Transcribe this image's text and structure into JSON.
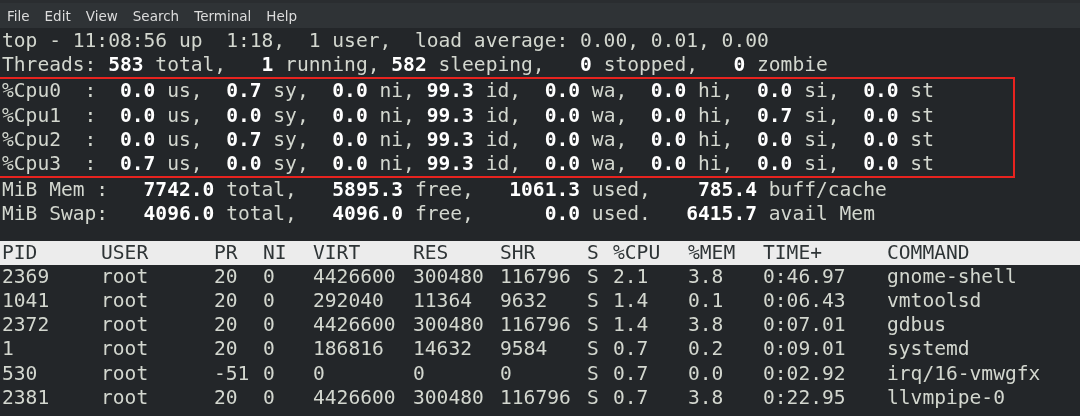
{
  "menu": [
    "File",
    "Edit",
    "View",
    "Search",
    "Terminal",
    "Help"
  ],
  "summary_lines": [
    "top - 11:08:56 up  1:18,  1 user,  load average: 0.00, 0.01, 0.00",
    "Threads: **583** total,   **1** running, **582** sleeping,   **0** stopped,   **0** zombie"
  ],
  "highlight_box": {
    "lines": [
      "%Cpu0  :  **0.0** us,  **0.7** sy,  **0.0** ni, **99.3** id,  **0.0** wa,  **0.0** hi,  **0.0** si,  **0.0** st",
      "%Cpu1  :  **0.0** us,  **0.0** sy,  **0.0** ni, **99.3** id,  **0.0** wa,  **0.0** hi,  **0.7** si,  **0.0** st",
      "%Cpu2  :  **0.0** us,  **0.7** sy,  **0.0** ni, **99.3** id,  **0.0** wa,  **0.0** hi,  **0.0** si,  **0.0** st",
      "%Cpu3  :  **0.7** us,  **0.0** sy,  **0.0** ni, **99.3** id,  **0.0** wa,  **0.0** hi,  **0.0** si,  **0.0** st"
    ]
  },
  "memory_lines": [
    "MiB Mem :   **7742.0** total,   **5895.3** free,   **1061.3** used,    **785.4** buff/cache",
    "MiB Swap:   **4096.0** total,   **4096.0** free,      **0.0** used.   **6415.7** avail Mem"
  ],
  "table": {
    "columns": [
      "PID",
      "USER",
      "PR",
      "NI",
      "VIRT",
      "RES",
      "SHR",
      "S",
      "%CPU",
      "%MEM",
      "TIME+",
      "COMMAND"
    ],
    "rows": [
      [
        "2369",
        "root",
        "20",
        "0",
        "4426600",
        "300480",
        "116796",
        "S",
        "2.1",
        "3.8",
        "0:46.97",
        "gnome-shell"
      ],
      [
        "1041",
        "root",
        "20",
        "0",
        "292040",
        "11364",
        "9632",
        "S",
        "1.4",
        "0.1",
        "0:06.43",
        "vmtoolsd"
      ],
      [
        "2372",
        "root",
        "20",
        "0",
        "4426600",
        "300480",
        "116796",
        "S",
        "1.4",
        "3.8",
        "0:07.01",
        "gdbus"
      ],
      [
        "1",
        "root",
        "20",
        "0",
        "186816",
        "14632",
        "9584",
        "S",
        "0.7",
        "0.2",
        "0:09.01",
        "systemd"
      ],
      [
        "530",
        "root",
        "-51",
        "0",
        "0",
        "0",
        "0",
        "S",
        "0.7",
        "0.0",
        "0:02.92",
        "irq/16-vmwgfx"
      ],
      [
        "2381",
        "root",
        "20",
        "0",
        "4426600",
        "300480",
        "116796",
        "S",
        "0.7",
        "3.8",
        "0:22.95",
        "llvmpipe-0"
      ]
    ]
  }
}
